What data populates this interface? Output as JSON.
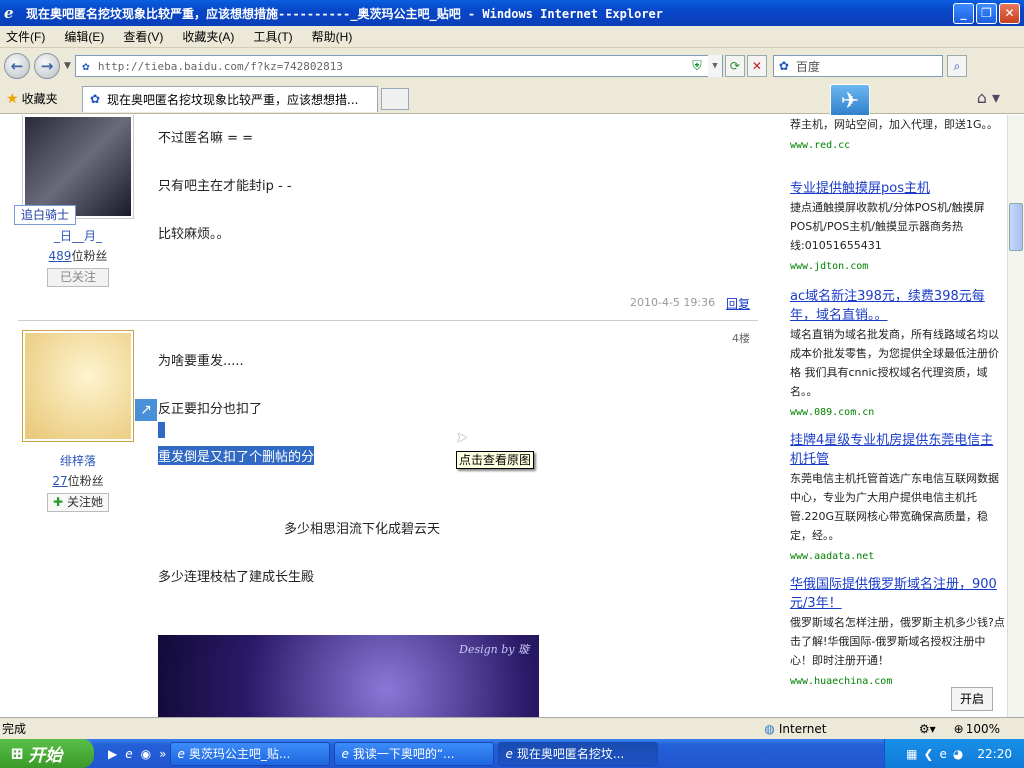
{
  "window": {
    "title": "现在奥吧匿名挖坟现象比较严重，应该想想措施----------_奥茨玛公主吧_贴吧 - Windows Internet Explorer"
  },
  "menu": [
    "文件(F)",
    "编辑(E)",
    "查看(V)",
    "收藏夹(A)",
    "工具(T)",
    "帮助(H)"
  ],
  "address": {
    "url": "http://tieba.baidu.com/f?kz=742802813"
  },
  "search": {
    "placeholder": "百度"
  },
  "favorites_label": "收藏夹",
  "tab": {
    "title": "现在奥吧匿名挖坟现象比较严重，应该想想措..."
  },
  "post1": {
    "badge": "追白骑士",
    "username": "_日__月_",
    "fans_count": "489",
    "fans_suffix": "位粉丝",
    "follow_label": "已关注",
    "lines": [
      "不过匿名嘛 = =",
      "只有吧主在才能封ip - -",
      "比较麻烦。。"
    ],
    "date": "2010-4-5 19:36",
    "reply": "回复"
  },
  "post2": {
    "floor": "4楼",
    "username": "绯梓落",
    "fans_count": "27",
    "fans_suffix": "位粉丝",
    "follow_label": "关注她",
    "lines": [
      "为啥要重发.....",
      "反正要扣分也扣了",
      "重发倒是又扣了个删帖的分",
      "多少相思泪流下化成碧云天",
      "多少连理枝枯了建成长生殿"
    ],
    "tooltip": "点击查看原图",
    "image_text": "Design by 璇"
  },
  "ads": [
    {
      "title": "",
      "desc": "荐主机，网站空间，加入代理，即送1G。。",
      "url": "www.red.cc"
    },
    {
      "title": "专业提供触摸屏pos主机",
      "desc": "捷点通触摸屏收款机/分体POS机/触摸屏POS机/POS主机/触摸显示器商务热线:01051655431",
      "url": "www.jdton.com"
    },
    {
      "title": "ac域名新注398元，续费398元每年，域名直销。。",
      "desc": "域名直销为域名批发商，所有线路域名均以成本价批发零售，为您提供全球最低注册价格 我们具有cnnic授权域名代理资质，域名。。",
      "url": "www.089.com.cn"
    },
    {
      "title": "挂牌4星级专业机房提供东莞电信主机托管",
      "desc": "东莞电信主机托管首选广东电信互联网数据中心，专业为广大用户提供电信主机托管.220G互联网核心带宽确保高质量，稳定，经。。",
      "url": "www.aadata.net"
    },
    {
      "title": "华俄国际提供俄罗斯域名注册，900元/3年！",
      "desc": "俄罗斯域名怎样注册，俄罗斯主机多少钱?点击了解!华俄国际-俄罗斯域名授权注册中心！即时注册开通！",
      "url": "www.huaechina.com"
    }
  ],
  "open_btn": "开启",
  "status": {
    "text": "完成",
    "zone": "Internet",
    "zoom": "100%"
  },
  "taskbar": {
    "start": "开始",
    "tasks": [
      "奥茨玛公主吧_贴...",
      "我读一下奥吧的“...",
      "现在奥吧匿名挖坟..."
    ],
    "time": "22:20"
  }
}
